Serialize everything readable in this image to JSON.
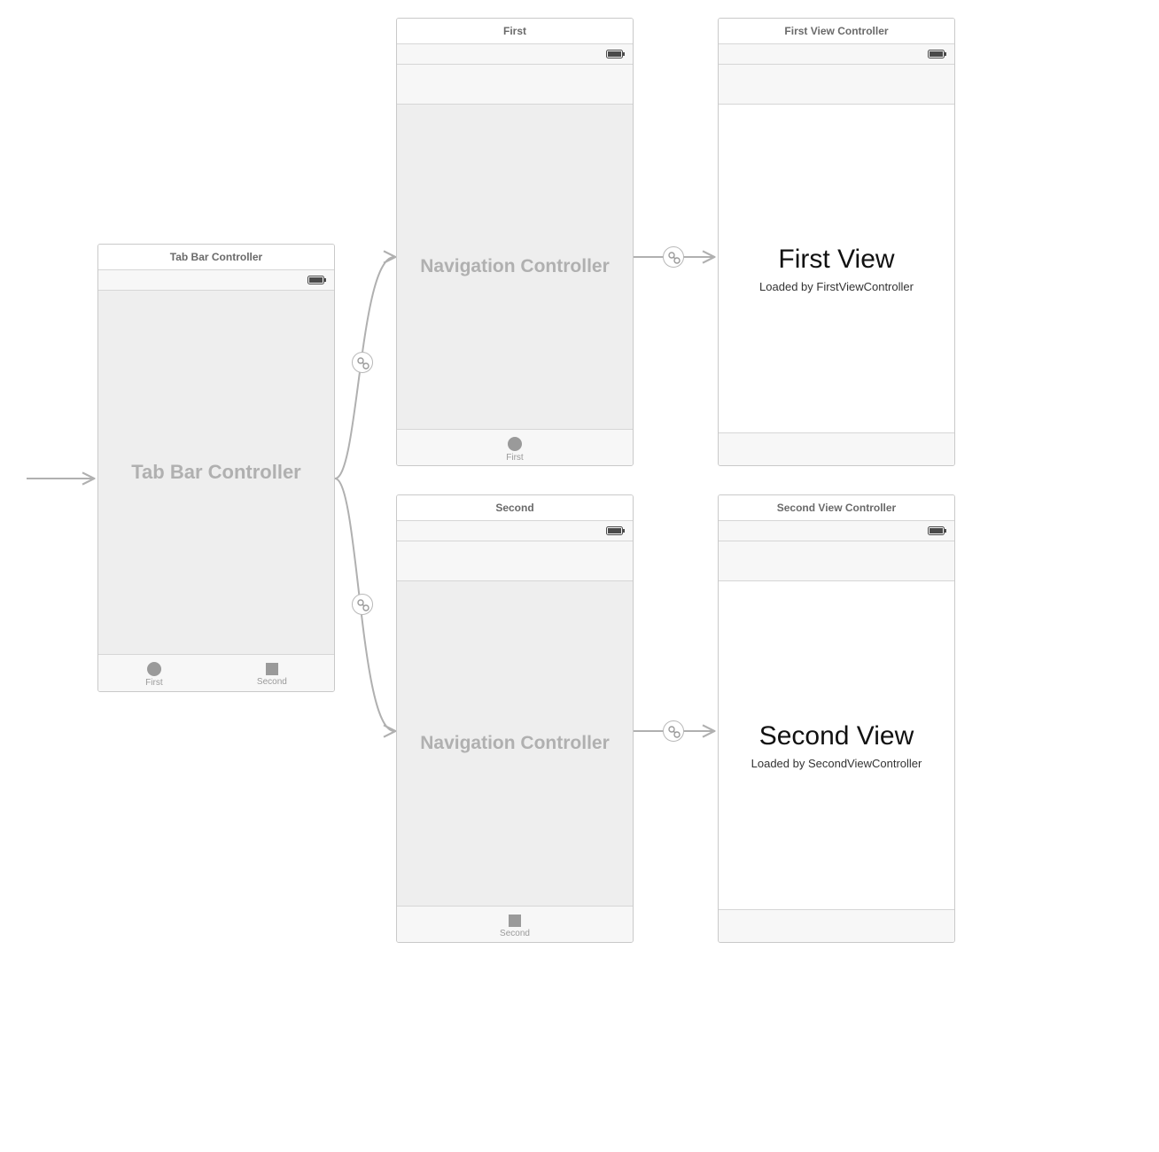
{
  "entryArrow": true,
  "tabBarController": {
    "title": "Tab Bar Controller",
    "placeholder": "Tab Bar Controller",
    "tabs": [
      {
        "label": "First",
        "iconShape": "circle"
      },
      {
        "label": "Second",
        "iconShape": "square"
      }
    ]
  },
  "navFirst": {
    "title": "First",
    "placeholder": "Navigation Controller",
    "tab": {
      "label": "First",
      "iconShape": "circle"
    }
  },
  "navSecond": {
    "title": "Second",
    "placeholder": "Navigation Controller",
    "tab": {
      "label": "Second",
      "iconShape": "square"
    }
  },
  "firstVC": {
    "title": "First View Controller",
    "heading": "First View",
    "subtitle": "Loaded by FirstViewController"
  },
  "secondVC": {
    "title": "Second View Controller",
    "heading": "Second View",
    "subtitle": "Loaded by SecondViewController"
  }
}
